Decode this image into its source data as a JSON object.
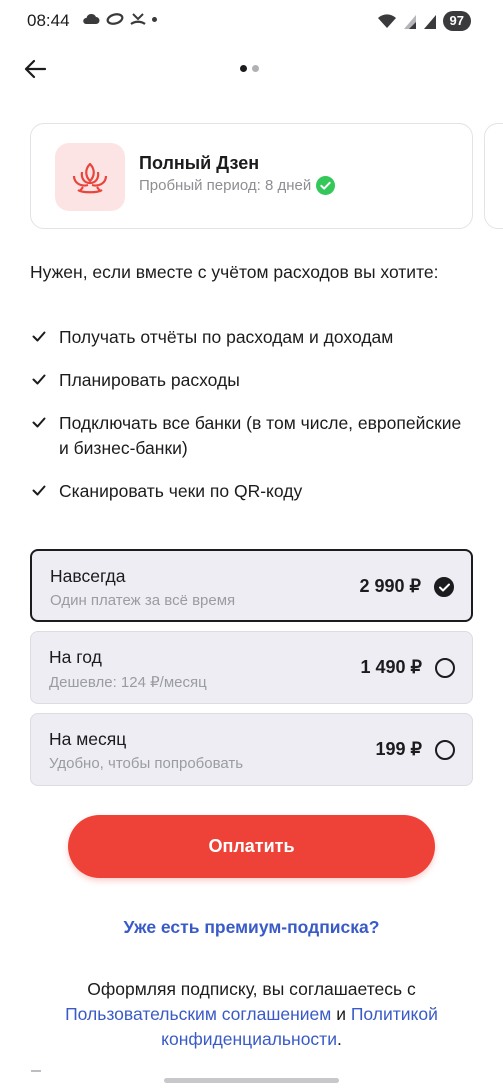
{
  "status_bar": {
    "time": "08:44",
    "battery": "97",
    "icons_left": [
      "cloud-icon",
      "link-icon",
      "missed-call-icon",
      "dot-icon"
    ],
    "icons_right": [
      "wifi-icon",
      "signal-icon",
      "signal-icon",
      "battery-icon"
    ]
  },
  "nav": {
    "back_icon": "arrow-left-icon",
    "pager": {
      "pages": 2,
      "current": 1
    }
  },
  "plan": {
    "title": "Полный Дзен",
    "trial": "Пробный период: 8 дней",
    "logo_icon": "lotus-icon",
    "badge_icon": "check-circle-icon",
    "badge_color": "#34c759"
  },
  "description": {
    "intro": "Нужен, если вместе с учётом расходов вы хотите:",
    "features": [
      "Получать отчёты по расходам и доходам",
      "Планировать расходы",
      "Подключать все банки (в том числе, европейские и бизнес-банки)",
      "Сканировать чеки по QR-коду"
    ]
  },
  "options": [
    {
      "title": "Навсегда",
      "subtitle": "Один платеж за всё время",
      "price": "2 990 ₽",
      "selected": true
    },
    {
      "title": "На год",
      "subtitle": "Дешевле: 124 ₽/месяц",
      "price": "1 490 ₽",
      "selected": false
    },
    {
      "title": "На месяц",
      "subtitle": "Удобно, чтобы попробовать",
      "price": "199 ₽",
      "selected": false
    }
  ],
  "pay_button": "Оплатить",
  "premium_link": "Уже есть премиум-подписка?",
  "legal": {
    "prefix": "Оформляя подписку, вы соглашаетесь с",
    "terms_link": "Пользовательским соглашением",
    "and": "и",
    "privacy_link": "Политикой конфиденциальности",
    "suffix": "."
  },
  "colors": {
    "accent": "#ee4238",
    "link": "#3a5bc7",
    "logo_bg": "#fde4e4",
    "option_bg": "#ededf3"
  }
}
